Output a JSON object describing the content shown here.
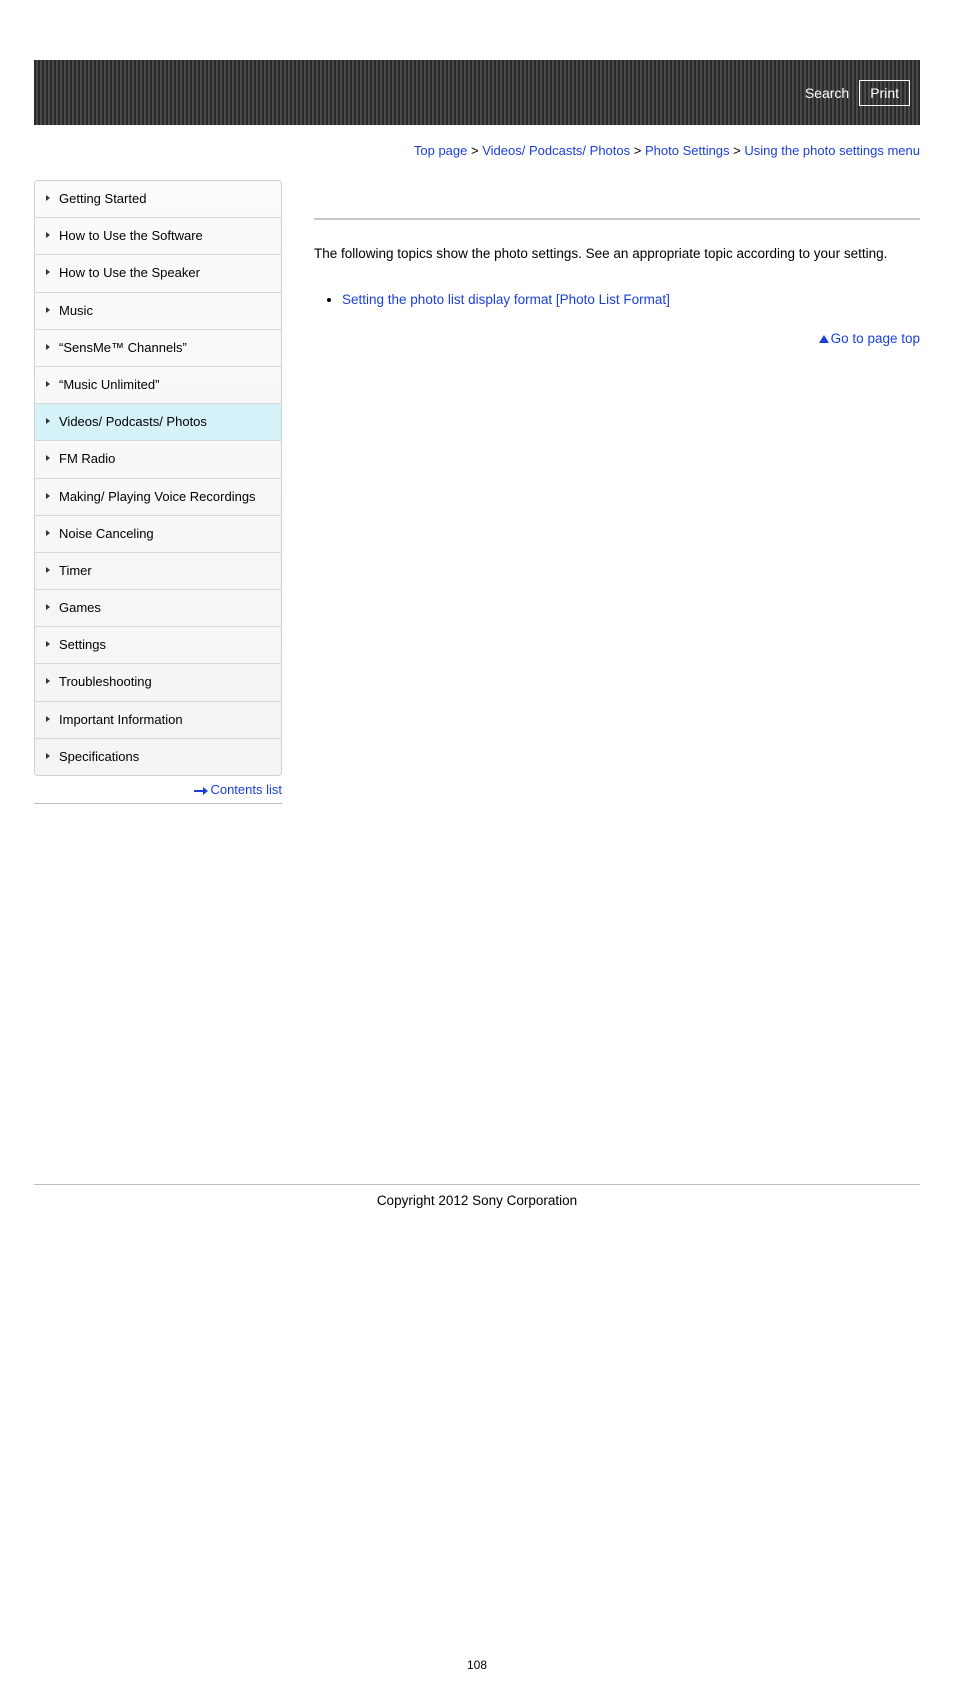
{
  "header": {
    "search_label": "Search",
    "print_label": "Print"
  },
  "breadcrumb": {
    "items": [
      "Top page",
      "Videos/ Podcasts/ Photos",
      "Photo Settings",
      "Using the photo settings menu"
    ],
    "separator": ">"
  },
  "sidebar": {
    "items": [
      "Getting Started",
      "How to Use the Software",
      "How to Use the Speaker",
      "Music",
      "“SensMe™ Channels”",
      "“Music Unlimited”",
      "Videos/ Podcasts/ Photos",
      "FM Radio",
      "Making/ Playing Voice Recordings",
      "Noise Canceling",
      "Timer",
      "Games",
      "Settings",
      "Troubleshooting",
      "Important Information",
      "Specifications"
    ],
    "active_index": 6,
    "contents_list_label": "Contents list"
  },
  "main": {
    "intro": "The following topics show the photo settings. See an appropriate topic according to your setting.",
    "topics": [
      "Setting the photo list display format [Photo List Format]"
    ],
    "page_top_label": "Go to page top"
  },
  "footer": {
    "copyright": "Copyright 2012 Sony Corporation",
    "page_number": "108"
  }
}
